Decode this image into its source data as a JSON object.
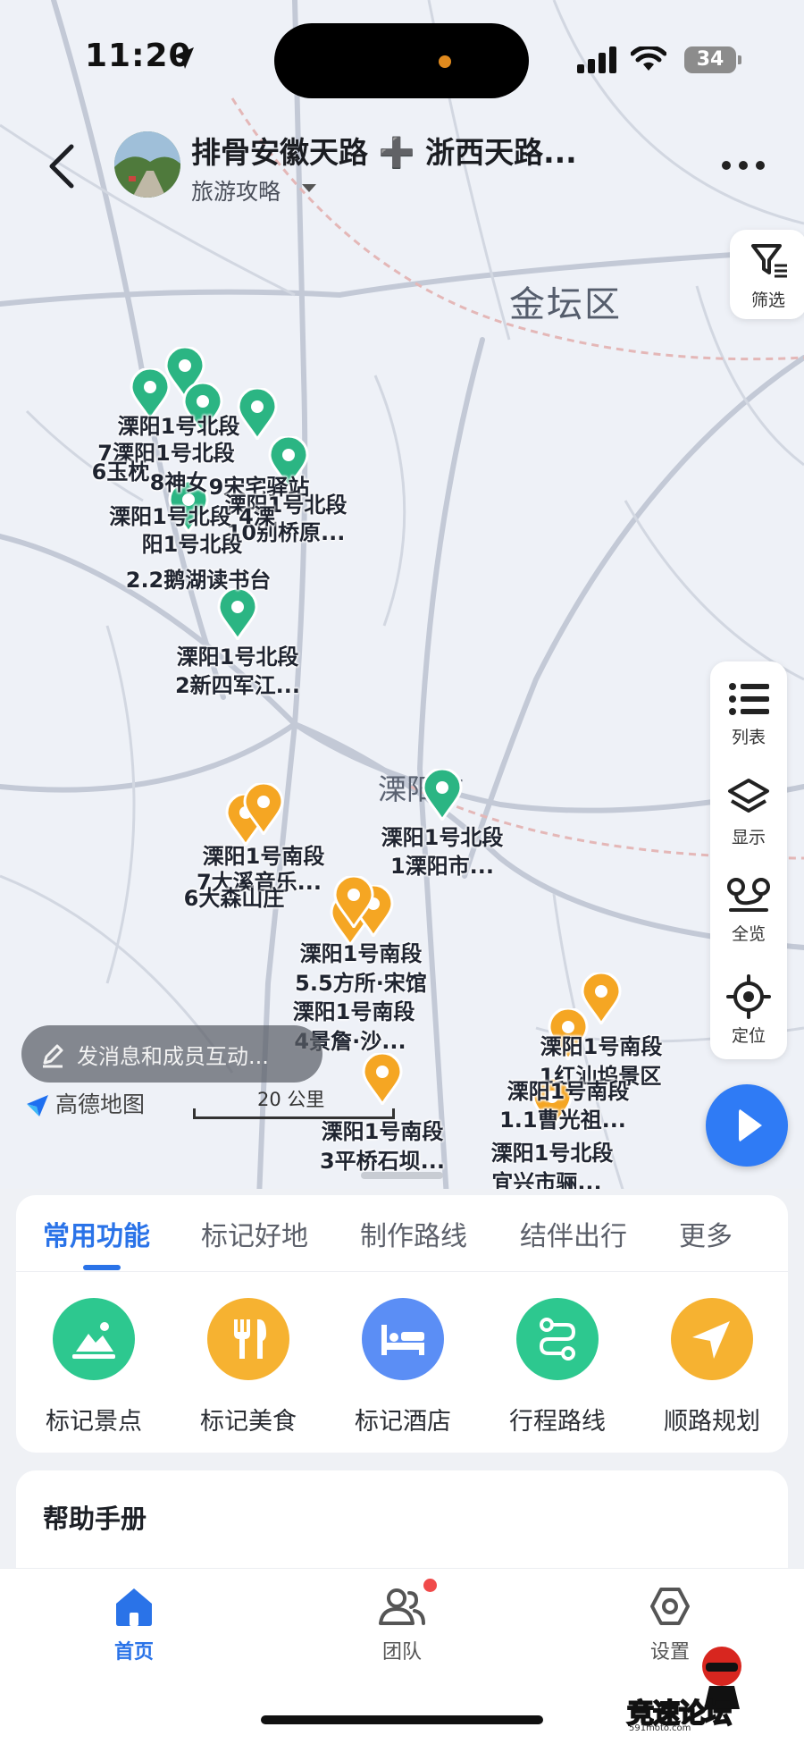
{
  "status_bar": {
    "time": "11:20",
    "battery": "34"
  },
  "header": {
    "title": "排骨安徽天路 ➕ 浙西天路...",
    "subtitle": "旅游攻略"
  },
  "map": {
    "district_label": "金坛区",
    "town_label": "溧阳市",
    "filter_label": "筛选",
    "tools": {
      "list": "列表",
      "layers": "显示",
      "overview": "全览",
      "locate": "定位"
    },
    "chat_placeholder": "发消息和成员互动...",
    "logo_text": "高德地图",
    "scale_text": "20 公里",
    "markers": [
      {
        "color": "green",
        "label": "溧阳1号北段"
      },
      {
        "color": "green",
        "label": "7溧阳1号北段"
      },
      {
        "color": "green",
        "label": "6玉枕"
      },
      {
        "color": "green",
        "label": "8神女"
      },
      {
        "color": "green",
        "label": "9宋宅驿站"
      },
      {
        "color": "green",
        "label": "溧阳1号北段 10别桥原..."
      },
      {
        "color": "green",
        "label": "溧阳1号北段 4溧阳1号北段"
      },
      {
        "color": "green",
        "label": "2.2鹅湖读书台"
      },
      {
        "color": "green",
        "label": "溧阳1号北段"
      },
      {
        "color": "green",
        "label": "2新四军江..."
      },
      {
        "color": "green",
        "label": "溧阳1号北段"
      },
      {
        "color": "green",
        "label": "1溧阳市..."
      },
      {
        "color": "orange",
        "label": "溧阳1号南段"
      },
      {
        "color": "orange",
        "label": "7大溪音乐..."
      },
      {
        "color": "orange",
        "label": "6大森山庄"
      },
      {
        "color": "orange",
        "label": "溧阳1号南段"
      },
      {
        "color": "orange",
        "label": "5.5方所·宋馆"
      },
      {
        "color": "orange",
        "label": "溧阳1号南段"
      },
      {
        "color": "orange",
        "label": "4景詹·沙..."
      },
      {
        "color": "orange",
        "label": "溧阳1号南段"
      },
      {
        "color": "orange",
        "label": "1红汕坞景区"
      },
      {
        "color": "orange",
        "label": "溧阳1号南段"
      },
      {
        "color": "orange",
        "label": "1.1曹光祖..."
      },
      {
        "color": "orange",
        "label": "溧阳1号南段"
      },
      {
        "color": "orange",
        "label": "3平桥石坝..."
      },
      {
        "color": "orange",
        "label": "溧阳1号北段"
      },
      {
        "color": "orange",
        "label": "宜兴市骊..."
      }
    ]
  },
  "panel": {
    "tabs": [
      "常用功能",
      "标记好地",
      "制作路线",
      "结伴出行",
      "更多"
    ],
    "actions": [
      {
        "label": "标记景点",
        "icon": "landscape-icon",
        "color": "#2dc88f"
      },
      {
        "label": "标记美食",
        "icon": "cutlery-icon",
        "color": "#f6b231"
      },
      {
        "label": "标记酒店",
        "icon": "bed-icon",
        "color": "#5b8ef5"
      },
      {
        "label": "行程路线",
        "icon": "route-icon",
        "color": "#2dc88f"
      },
      {
        "label": "顺路规划",
        "icon": "navigate-arrow-icon",
        "color": "#f6b231"
      }
    ],
    "help_title": "帮助手册"
  },
  "tabbar": {
    "home": "首页",
    "team": "团队",
    "settings": "设置"
  },
  "watermark": {
    "text": "竞速论坛",
    "url": "591moto.com"
  },
  "colors": {
    "accent": "#2a73e8",
    "marker_green": "#2bb583",
    "marker_orange": "#f5a623"
  }
}
